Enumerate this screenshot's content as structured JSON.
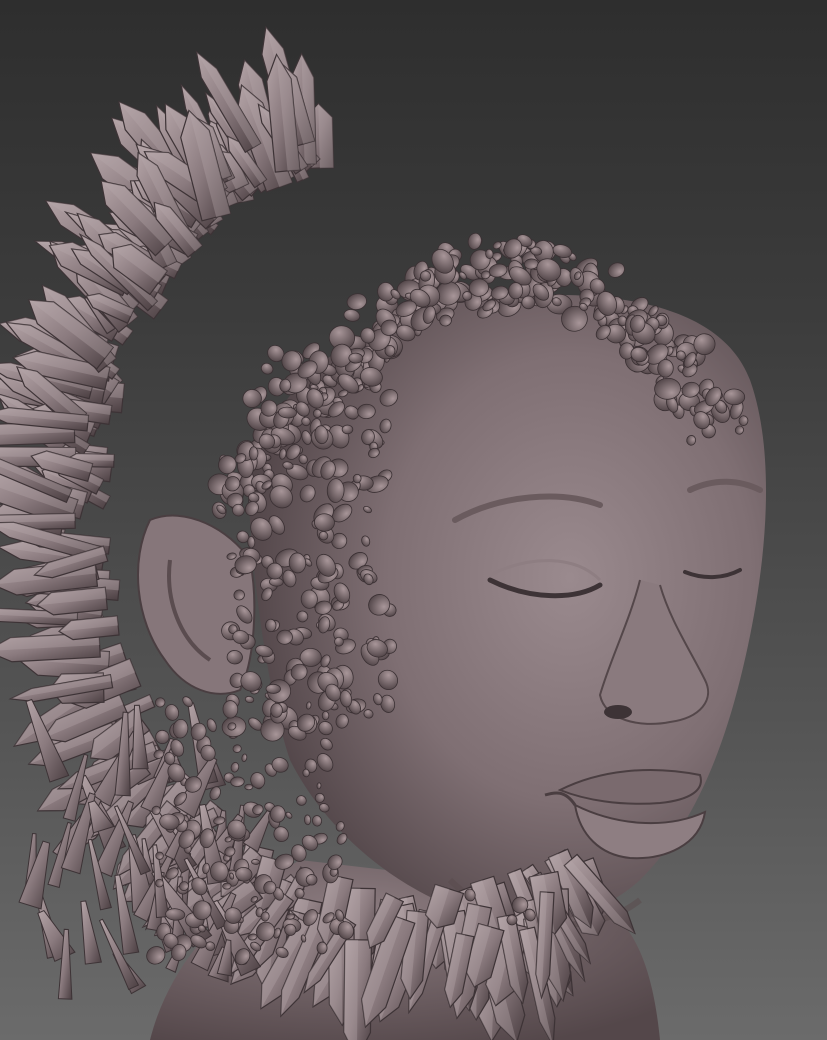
{
  "image": {
    "subject": "sculpt-render",
    "material_colors": {
      "base": "#7d6d70",
      "light": "#a8989b",
      "mid": "#8a7a7e",
      "dark": "#4a3e41",
      "shadow": "#2f2628"
    },
    "background_colors": {
      "top": "#2e2e2e",
      "bottom": "#6b6b6b"
    }
  }
}
